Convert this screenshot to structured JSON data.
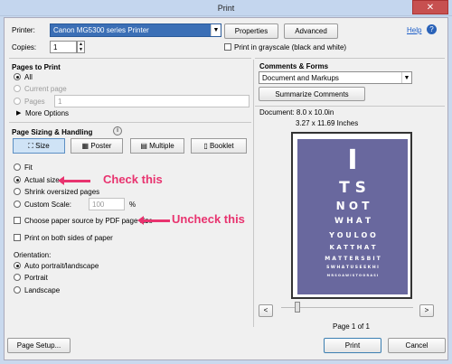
{
  "window": {
    "title": "Print",
    "close_glyph": "✕"
  },
  "top": {
    "printer_label": "Printer:",
    "printer_value": "Canon MG5300 series Printer",
    "properties_label": "Properties",
    "advanced_label": "Advanced",
    "help_label": "Help",
    "copies_label": "Copies:",
    "copies_value": "1",
    "grayscale_label": "Print in grayscale (black and white)"
  },
  "pages_to_print": {
    "title": "Pages to Print",
    "all_label": "All",
    "current_label": "Current page",
    "pages_label": "Pages",
    "pages_value": "1",
    "more_options_label": "More Options"
  },
  "sizing": {
    "title": "Page Sizing & Handling",
    "tabs": [
      {
        "label": "Size",
        "icon": "size-icon"
      },
      {
        "label": "Poster",
        "icon": "poster-icon"
      },
      {
        "label": "Multiple",
        "icon": "multiple-icon"
      },
      {
        "label": "Booklet",
        "icon": "booklet-icon"
      }
    ],
    "fit_label": "Fit",
    "actual_label": "Actual size",
    "shrink_label": "Shrink oversized pages",
    "custom_label": "Custom Scale:",
    "custom_value": "100",
    "percent": "%",
    "paper_source_label": "Choose paper source by PDF page size",
    "both_sides_label": "Print on both sides of paper"
  },
  "orientation": {
    "title": "Orientation:",
    "auto_label": "Auto portrait/landscape",
    "portrait_label": "Portrait",
    "landscape_label": "Landscape"
  },
  "comments": {
    "title": "Comments & Forms",
    "value": "Document and Markups",
    "summarize_label": "Summarize Comments"
  },
  "preview": {
    "document_label": "Document: 8.0 x 10.0in",
    "size_label": "3.27 x 11.69 Inches",
    "eye_lines": [
      "I",
      "T S",
      "N O T",
      "W H A T",
      "Y O U L O O",
      "K A T T H A T",
      "M A T T E R S B I T",
      "S W H A T U S E E K H I",
      "M R S O A W I S T O O R A S I"
    ],
    "prev_glyph": "<",
    "next_glyph": ">",
    "page_label": "Page 1 of 1"
  },
  "bottom": {
    "page_setup_label": "Page Setup...",
    "print_label": "Print",
    "cancel_label": "Cancel"
  },
  "annotations": {
    "check_label": "Check this",
    "uncheck_label": "Uncheck this",
    "color": "#e8336f"
  }
}
